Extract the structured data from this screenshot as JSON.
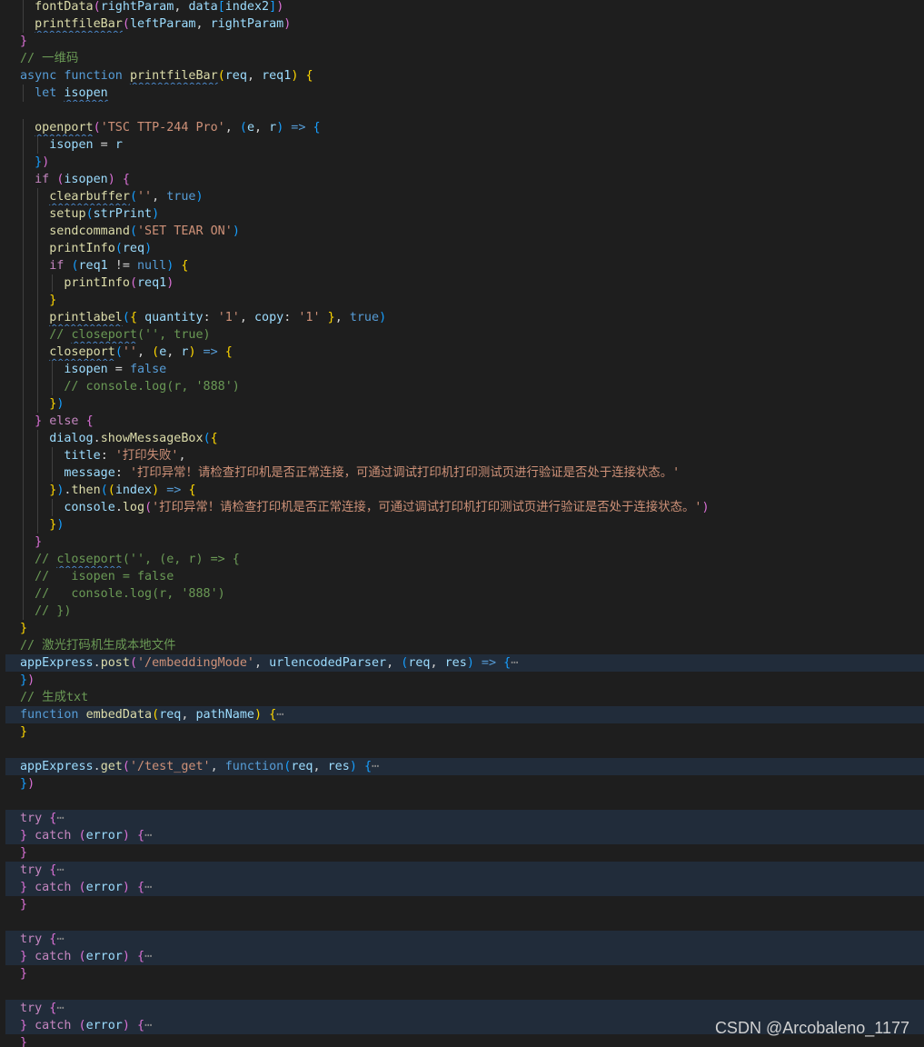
{
  "watermark": "CSDN @Arcobaleno_1177",
  "lines": [
    {
      "fold": false,
      "indent": 1,
      "tokens": [
        [
          "fn",
          "fontData"
        ],
        [
          "b2",
          "("
        ],
        [
          "vr",
          "rightParam"
        ],
        [
          "pn",
          ", "
        ],
        [
          "vr",
          "data"
        ],
        [
          "b3",
          "["
        ],
        [
          "vr",
          "index2"
        ],
        [
          "b3",
          "]"
        ],
        [
          "b2",
          ")"
        ]
      ]
    },
    {
      "fold": false,
      "indent": 1,
      "tokens": [
        [
          "fn sq",
          "printfileBar"
        ],
        [
          "b2",
          "("
        ],
        [
          "vr",
          "leftParam"
        ],
        [
          "pn",
          ", "
        ],
        [
          "vr",
          "rightParam"
        ],
        [
          "b2",
          ")"
        ]
      ]
    },
    {
      "fold": false,
      "indent": 0,
      "tokens": [
        [
          "b2",
          "}"
        ]
      ]
    },
    {
      "fold": false,
      "indent": 0,
      "tokens": [
        [
          "cm",
          "// 一维码"
        ]
      ]
    },
    {
      "fold": false,
      "indent": 0,
      "tokens": [
        [
          "kw",
          "async "
        ],
        [
          "kw",
          "function "
        ],
        [
          "fn sq",
          "printfileBar"
        ],
        [
          "b1",
          "("
        ],
        [
          "vr",
          "req"
        ],
        [
          "pn",
          ", "
        ],
        [
          "vr",
          "req1"
        ],
        [
          "b1",
          ")"
        ],
        [
          "pn",
          " "
        ],
        [
          "b1",
          "{"
        ]
      ]
    },
    {
      "fold": false,
      "indent": 1,
      "tokens": [
        [
          "kw",
          "let "
        ],
        [
          "vr sq",
          "isopen"
        ]
      ]
    },
    {
      "fold": false,
      "indent": 0,
      "tokens": []
    },
    {
      "fold": false,
      "indent": 1,
      "tokens": [
        [
          "fn sq",
          "openport"
        ],
        [
          "b2",
          "("
        ],
        [
          "str",
          "'TSC TTP-244 Pro'"
        ],
        [
          "pn",
          ", "
        ],
        [
          "b3",
          "("
        ],
        [
          "vr",
          "e"
        ],
        [
          "pn",
          ", "
        ],
        [
          "vr",
          "r"
        ],
        [
          "b3",
          ")"
        ],
        [
          "kw",
          " => "
        ],
        [
          "b3",
          "{"
        ]
      ]
    },
    {
      "fold": false,
      "indent": 2,
      "tokens": [
        [
          "vr",
          "isopen"
        ],
        [
          "pn",
          " = "
        ],
        [
          "vr",
          "r"
        ]
      ]
    },
    {
      "fold": false,
      "indent": 1,
      "tokens": [
        [
          "b3",
          "}"
        ],
        [
          "b2",
          ")"
        ]
      ]
    },
    {
      "fold": false,
      "indent": 1,
      "tokens": [
        [
          "kwc",
          "if "
        ],
        [
          "b2",
          "("
        ],
        [
          "vr",
          "isopen"
        ],
        [
          "b2",
          ")"
        ],
        [
          "pn",
          " "
        ],
        [
          "b2",
          "{"
        ]
      ]
    },
    {
      "fold": false,
      "indent": 2,
      "tokens": [
        [
          "fn sq",
          "clearbuffer"
        ],
        [
          "b3",
          "("
        ],
        [
          "str",
          "''"
        ],
        [
          "pn",
          ", "
        ],
        [
          "kw",
          "true"
        ],
        [
          "b3",
          ")"
        ]
      ]
    },
    {
      "fold": false,
      "indent": 2,
      "tokens": [
        [
          "fn",
          "setup"
        ],
        [
          "b3",
          "("
        ],
        [
          "vr",
          "strPrint"
        ],
        [
          "b3",
          ")"
        ]
      ]
    },
    {
      "fold": false,
      "indent": 2,
      "tokens": [
        [
          "fn",
          "sendcommand"
        ],
        [
          "b3",
          "("
        ],
        [
          "str",
          "'SET TEAR ON'"
        ],
        [
          "b3",
          ")"
        ]
      ]
    },
    {
      "fold": false,
      "indent": 2,
      "tokens": [
        [
          "fn",
          "printInfo"
        ],
        [
          "b3",
          "("
        ],
        [
          "vr",
          "req"
        ],
        [
          "b3",
          ")"
        ]
      ]
    },
    {
      "fold": false,
      "indent": 2,
      "tokens": [
        [
          "kwc",
          "if "
        ],
        [
          "b3",
          "("
        ],
        [
          "vr",
          "req1"
        ],
        [
          "pn",
          " != "
        ],
        [
          "kw",
          "null"
        ],
        [
          "b3",
          ")"
        ],
        [
          "pn",
          " "
        ],
        [
          "b1",
          "{"
        ]
      ]
    },
    {
      "fold": false,
      "indent": 3,
      "tokens": [
        [
          "fn",
          "printInfo"
        ],
        [
          "b2",
          "("
        ],
        [
          "vr",
          "req1"
        ],
        [
          "b2",
          ")"
        ]
      ]
    },
    {
      "fold": false,
      "indent": 2,
      "tokens": [
        [
          "b1",
          "}"
        ]
      ]
    },
    {
      "fold": false,
      "indent": 2,
      "tokens": [
        [
          "fn sq",
          "printlabel"
        ],
        [
          "b3",
          "("
        ],
        [
          "b1",
          "{"
        ],
        [
          "pn",
          " "
        ],
        [
          "vr",
          "quantity"
        ],
        [
          "pn",
          ": "
        ],
        [
          "str",
          "'1'"
        ],
        [
          "pn",
          ", "
        ],
        [
          "vr",
          "copy"
        ],
        [
          "pn",
          ": "
        ],
        [
          "str",
          "'1'"
        ],
        [
          "pn",
          " "
        ],
        [
          "b1",
          "}"
        ],
        [
          "pn",
          ", "
        ],
        [
          "kw",
          "true"
        ],
        [
          "b3",
          ")"
        ]
      ]
    },
    {
      "fold": false,
      "indent": 2,
      "tokens": [
        [
          "cm",
          "// "
        ],
        [
          "cm sq",
          "closeport"
        ],
        [
          "cm",
          "('', true)"
        ]
      ]
    },
    {
      "fold": false,
      "indent": 2,
      "tokens": [
        [
          "fn sq",
          "closeport"
        ],
        [
          "b3",
          "("
        ],
        [
          "str",
          "''"
        ],
        [
          "pn",
          ", "
        ],
        [
          "b1",
          "("
        ],
        [
          "vr",
          "e"
        ],
        [
          "pn",
          ", "
        ],
        [
          "vr",
          "r"
        ],
        [
          "b1",
          ")"
        ],
        [
          "kw",
          " => "
        ],
        [
          "b1",
          "{"
        ]
      ]
    },
    {
      "fold": false,
      "indent": 3,
      "tokens": [
        [
          "vr",
          "isopen"
        ],
        [
          "pn",
          " = "
        ],
        [
          "kw",
          "false"
        ]
      ]
    },
    {
      "fold": false,
      "indent": 3,
      "tokens": [
        [
          "cm",
          "// console.log(r, '888')"
        ]
      ]
    },
    {
      "fold": false,
      "indent": 2,
      "tokens": [
        [
          "b1",
          "}"
        ],
        [
          "b3",
          ")"
        ]
      ]
    },
    {
      "fold": false,
      "indent": 1,
      "tokens": [
        [
          "b2",
          "}"
        ],
        [
          "kwc",
          " else "
        ],
        [
          "b2",
          "{"
        ]
      ]
    },
    {
      "fold": false,
      "indent": 2,
      "tokens": [
        [
          "vr",
          "dialog"
        ],
        [
          "pn",
          "."
        ],
        [
          "fn",
          "showMessageBox"
        ],
        [
          "b3",
          "("
        ],
        [
          "b1",
          "{"
        ]
      ]
    },
    {
      "fold": false,
      "indent": 3,
      "tokens": [
        [
          "vr",
          "title"
        ],
        [
          "pn",
          ": "
        ],
        [
          "str",
          "'打印失败'"
        ],
        [
          "pn",
          ","
        ]
      ]
    },
    {
      "fold": false,
      "indent": 3,
      "tokens": [
        [
          "vr",
          "message"
        ],
        [
          "pn",
          ": "
        ],
        [
          "str",
          "'打印异常！请检查打印机是否正常连接，可通过调试打印机打印测试页进行验证是否处于连接状态。'"
        ]
      ]
    },
    {
      "fold": false,
      "indent": 2,
      "tokens": [
        [
          "b1",
          "}"
        ],
        [
          "b3",
          ")"
        ],
        [
          "pn",
          "."
        ],
        [
          "fn",
          "then"
        ],
        [
          "b3",
          "("
        ],
        [
          "b1",
          "("
        ],
        [
          "vr",
          "index"
        ],
        [
          "b1",
          ")"
        ],
        [
          "kw",
          " => "
        ],
        [
          "b1",
          "{"
        ]
      ]
    },
    {
      "fold": false,
      "indent": 3,
      "tokens": [
        [
          "vr",
          "console"
        ],
        [
          "pn",
          "."
        ],
        [
          "fn",
          "log"
        ],
        [
          "b2",
          "("
        ],
        [
          "str",
          "'打印异常！请检查打印机是否正常连接，可通过调试打印机打印测试页进行验证是否处于连接状态。'"
        ],
        [
          "b2",
          ")"
        ]
      ]
    },
    {
      "fold": false,
      "indent": 2,
      "tokens": [
        [
          "b1",
          "}"
        ],
        [
          "b3",
          ")"
        ]
      ]
    },
    {
      "fold": false,
      "indent": 1,
      "tokens": [
        [
          "b2",
          "}"
        ]
      ]
    },
    {
      "fold": false,
      "indent": 1,
      "tokens": [
        [
          "cm",
          "// "
        ],
        [
          "cm sq",
          "closeport"
        ],
        [
          "cm",
          "('', (e, r) => {"
        ]
      ]
    },
    {
      "fold": false,
      "indent": 1,
      "tokens": [
        [
          "cm",
          "//   isopen = false"
        ]
      ]
    },
    {
      "fold": false,
      "indent": 1,
      "tokens": [
        [
          "cm",
          "//   console.log(r, '888')"
        ]
      ]
    },
    {
      "fold": false,
      "indent": 1,
      "tokens": [
        [
          "cm",
          "// })"
        ]
      ]
    },
    {
      "fold": false,
      "indent": 0,
      "tokens": [
        [
          "b1",
          "}"
        ]
      ]
    },
    {
      "fold": false,
      "indent": 0,
      "tokens": [
        [
          "cm",
          "// 激光打码机生成本地文件"
        ]
      ]
    },
    {
      "fold": true,
      "indent": 0,
      "tokens": [
        [
          "vr",
          "appExpress"
        ],
        [
          "pn",
          "."
        ],
        [
          "fn",
          "post"
        ],
        [
          "b2",
          "("
        ],
        [
          "str",
          "'/embeddingMode'"
        ],
        [
          "pn",
          ", "
        ],
        [
          "vr",
          "urlencodedParser"
        ],
        [
          "pn",
          ", "
        ],
        [
          "b3",
          "("
        ],
        [
          "vr",
          "req"
        ],
        [
          "pn",
          ", "
        ],
        [
          "vr",
          "res"
        ],
        [
          "b3",
          ")"
        ],
        [
          "kw",
          " => "
        ],
        [
          "b3",
          "{"
        ],
        [
          "ell",
          "⋯"
        ]
      ]
    },
    {
      "fold": false,
      "indent": 0,
      "tokens": [
        [
          "b3",
          "}"
        ],
        [
          "b2",
          ")"
        ]
      ]
    },
    {
      "fold": false,
      "indent": 0,
      "tokens": [
        [
          "cm",
          "// 生成txt"
        ]
      ]
    },
    {
      "fold": true,
      "indent": 0,
      "tokens": [
        [
          "kw",
          "function "
        ],
        [
          "fn",
          "embedData"
        ],
        [
          "b1",
          "("
        ],
        [
          "vr",
          "req"
        ],
        [
          "pn",
          ", "
        ],
        [
          "vr",
          "pathName"
        ],
        [
          "b1",
          ")"
        ],
        [
          "pn",
          " "
        ],
        [
          "b1",
          "{"
        ],
        [
          "ell",
          "⋯"
        ]
      ]
    },
    {
      "fold": false,
      "indent": 0,
      "tokens": [
        [
          "b1",
          "}"
        ]
      ]
    },
    {
      "fold": false,
      "indent": 0,
      "tokens": []
    },
    {
      "fold": true,
      "indent": 0,
      "tokens": [
        [
          "vr",
          "appExpress"
        ],
        [
          "pn",
          "."
        ],
        [
          "fn",
          "get"
        ],
        [
          "b2",
          "("
        ],
        [
          "str",
          "'/test_get'"
        ],
        [
          "pn",
          ", "
        ],
        [
          "kw",
          "function"
        ],
        [
          "b3",
          "("
        ],
        [
          "vr",
          "req"
        ],
        [
          "pn",
          ", "
        ],
        [
          "vr",
          "res"
        ],
        [
          "b3",
          ")"
        ],
        [
          "pn",
          " "
        ],
        [
          "b3",
          "{"
        ],
        [
          "ell",
          "⋯"
        ]
      ]
    },
    {
      "fold": false,
      "indent": 0,
      "tokens": [
        [
          "b3",
          "}"
        ],
        [
          "b2",
          ")"
        ]
      ]
    },
    {
      "fold": false,
      "indent": 0,
      "tokens": []
    },
    {
      "fold": true,
      "indent": 0,
      "tokens": [
        [
          "kwc",
          "try "
        ],
        [
          "b2",
          "{"
        ],
        [
          "ell",
          "⋯"
        ]
      ]
    },
    {
      "fold": true,
      "indent": 0,
      "tokens": [
        [
          "b2",
          "}"
        ],
        [
          "kwc",
          " catch "
        ],
        [
          "b2",
          "("
        ],
        [
          "vr",
          "error"
        ],
        [
          "b2",
          ")"
        ],
        [
          "pn",
          " "
        ],
        [
          "b2",
          "{"
        ],
        [
          "ell",
          "⋯"
        ]
      ]
    },
    {
      "fold": false,
      "indent": 0,
      "tokens": [
        [
          "b2",
          "}"
        ]
      ]
    },
    {
      "fold": true,
      "indent": 0,
      "tokens": [
        [
          "kwc",
          "try "
        ],
        [
          "b2",
          "{"
        ],
        [
          "ell",
          "⋯"
        ]
      ]
    },
    {
      "fold": true,
      "indent": 0,
      "tokens": [
        [
          "b2",
          "}"
        ],
        [
          "kwc",
          " catch "
        ],
        [
          "b2",
          "("
        ],
        [
          "vr",
          "error"
        ],
        [
          "b2",
          ")"
        ],
        [
          "pn",
          " "
        ],
        [
          "b2",
          "{"
        ],
        [
          "ell",
          "⋯"
        ]
      ]
    },
    {
      "fold": false,
      "indent": 0,
      "tokens": [
        [
          "b2",
          "}"
        ]
      ]
    },
    {
      "fold": false,
      "indent": 0,
      "tokens": []
    },
    {
      "fold": true,
      "indent": 0,
      "tokens": [
        [
          "kwc",
          "try "
        ],
        [
          "b2",
          "{"
        ],
        [
          "ell",
          "⋯"
        ]
      ]
    },
    {
      "fold": true,
      "indent": 0,
      "tokens": [
        [
          "b2",
          "}"
        ],
        [
          "kwc",
          " catch "
        ],
        [
          "b2",
          "("
        ],
        [
          "vr",
          "error"
        ],
        [
          "b2",
          ")"
        ],
        [
          "pn",
          " "
        ],
        [
          "b2",
          "{"
        ],
        [
          "ell",
          "⋯"
        ]
      ]
    },
    {
      "fold": false,
      "indent": 0,
      "tokens": [
        [
          "b2",
          "}"
        ]
      ]
    },
    {
      "fold": false,
      "indent": 0,
      "tokens": []
    },
    {
      "fold": true,
      "indent": 0,
      "tokens": [
        [
          "kwc",
          "try "
        ],
        [
          "b2",
          "{"
        ],
        [
          "ell",
          "⋯"
        ]
      ]
    },
    {
      "fold": true,
      "indent": 0,
      "tokens": [
        [
          "b2",
          "}"
        ],
        [
          "kwc",
          " catch "
        ],
        [
          "b2",
          "("
        ],
        [
          "vr",
          "error"
        ],
        [
          "b2",
          ")"
        ],
        [
          "pn",
          " "
        ],
        [
          "b2",
          "{"
        ],
        [
          "ell",
          "⋯"
        ]
      ]
    },
    {
      "fold": false,
      "indent": 0,
      "tokens": [
        [
          "b2",
          "}"
        ]
      ]
    }
  ]
}
